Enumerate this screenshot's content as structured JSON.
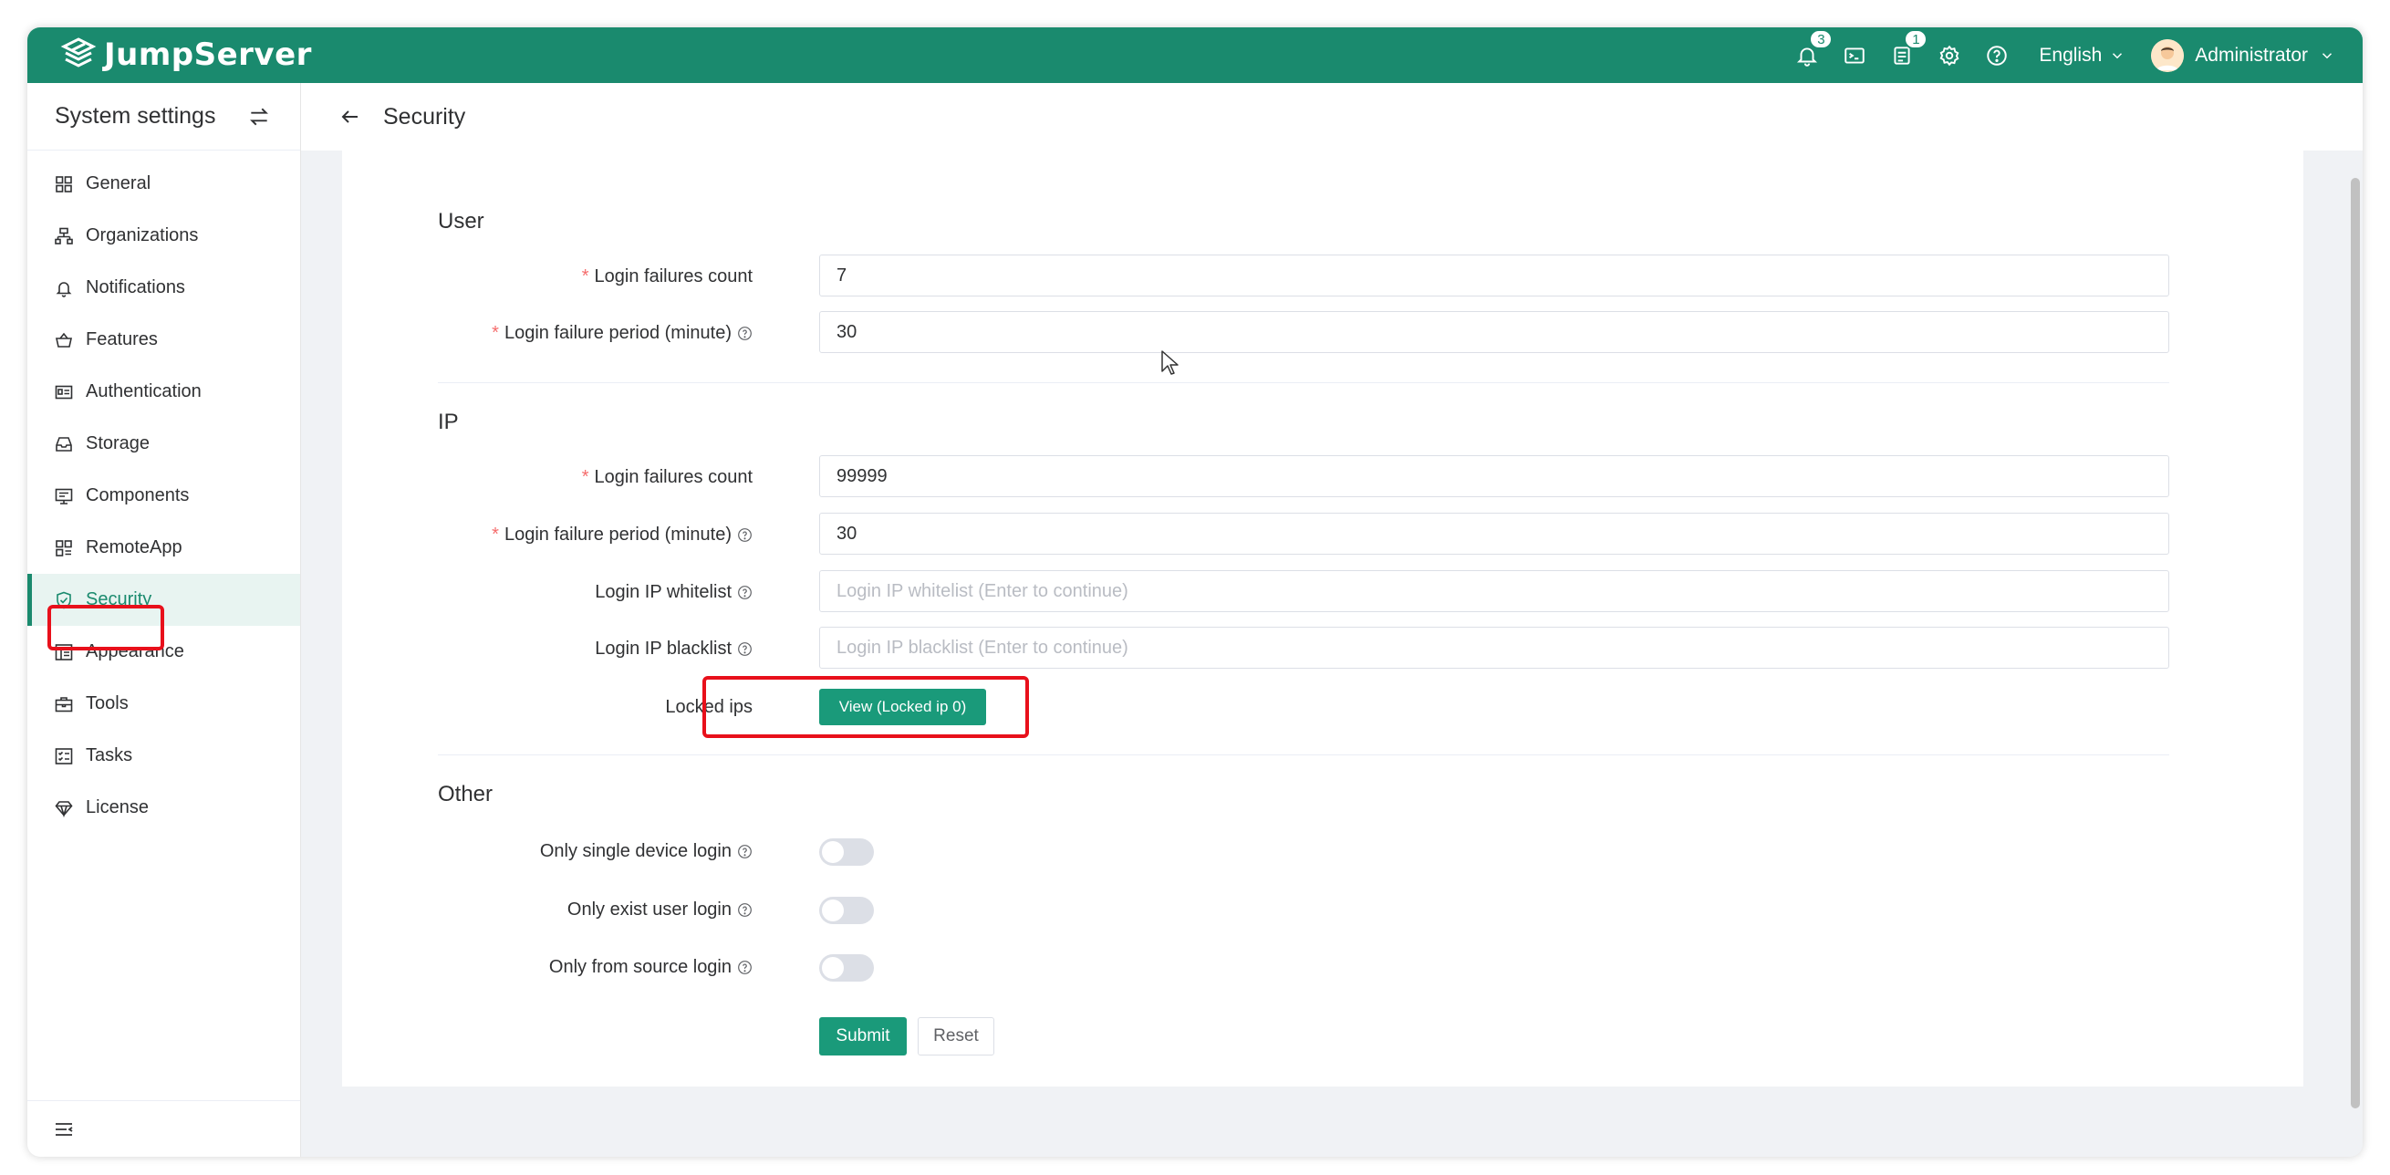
{
  "brand": {
    "name": "JumpServer"
  },
  "topbar": {
    "notifications_badge": "3",
    "tickets_badge": "1",
    "language": "English",
    "user_name": "Administrator"
  },
  "sidebar": {
    "title": "System settings",
    "items": [
      {
        "label": "General",
        "icon": "grid-icon"
      },
      {
        "label": "Organizations",
        "icon": "org-tree-icon"
      },
      {
        "label": "Notifications",
        "icon": "bell-icon"
      },
      {
        "label": "Features",
        "icon": "basket-icon"
      },
      {
        "label": "Authentication",
        "icon": "id-card-icon"
      },
      {
        "label": "Storage",
        "icon": "inbox-icon"
      },
      {
        "label": "Components",
        "icon": "monitor-icon"
      },
      {
        "label": "RemoteApp",
        "icon": "apps-icon"
      },
      {
        "label": "Security",
        "icon": "shield-icon",
        "active": true
      },
      {
        "label": "Appearance",
        "icon": "layout-icon"
      },
      {
        "label": "Tools",
        "icon": "toolbox-icon"
      },
      {
        "label": "Tasks",
        "icon": "checklist-icon"
      },
      {
        "label": "License",
        "icon": "diamond-icon"
      }
    ]
  },
  "page": {
    "title": "Security"
  },
  "form": {
    "user": {
      "title": "User",
      "failures_count_label": "Login failures count",
      "failures_count_value": "7",
      "failure_period_label": "Login failure period (minute)",
      "failure_period_value": "30"
    },
    "ip": {
      "title": "IP",
      "failures_count_label": "Login failures count",
      "failures_count_value": "99999",
      "failure_period_label": "Login failure period (minute)",
      "failure_period_value": "30",
      "whitelist_label": "Login IP whitelist",
      "whitelist_placeholder": "Login IP whitelist (Enter to continue)",
      "blacklist_label": "Login IP blacklist",
      "blacklist_placeholder": "Login IP blacklist (Enter to continue)",
      "locked_label": "Locked ips",
      "locked_button": "View (Locked ip 0)"
    },
    "other": {
      "title": "Other",
      "single_device_label": "Only single device login",
      "single_device_on": false,
      "exist_user_label": "Only exist user login",
      "exist_user_on": false,
      "from_source_label": "Only from source login",
      "from_source_on": false
    },
    "submit_label": "Submit",
    "reset_label": "Reset"
  },
  "colors": {
    "brand": "#1a8a6e",
    "button": "#1a9a7a",
    "highlight": "#e8101b",
    "required": "#f56c6c"
  }
}
